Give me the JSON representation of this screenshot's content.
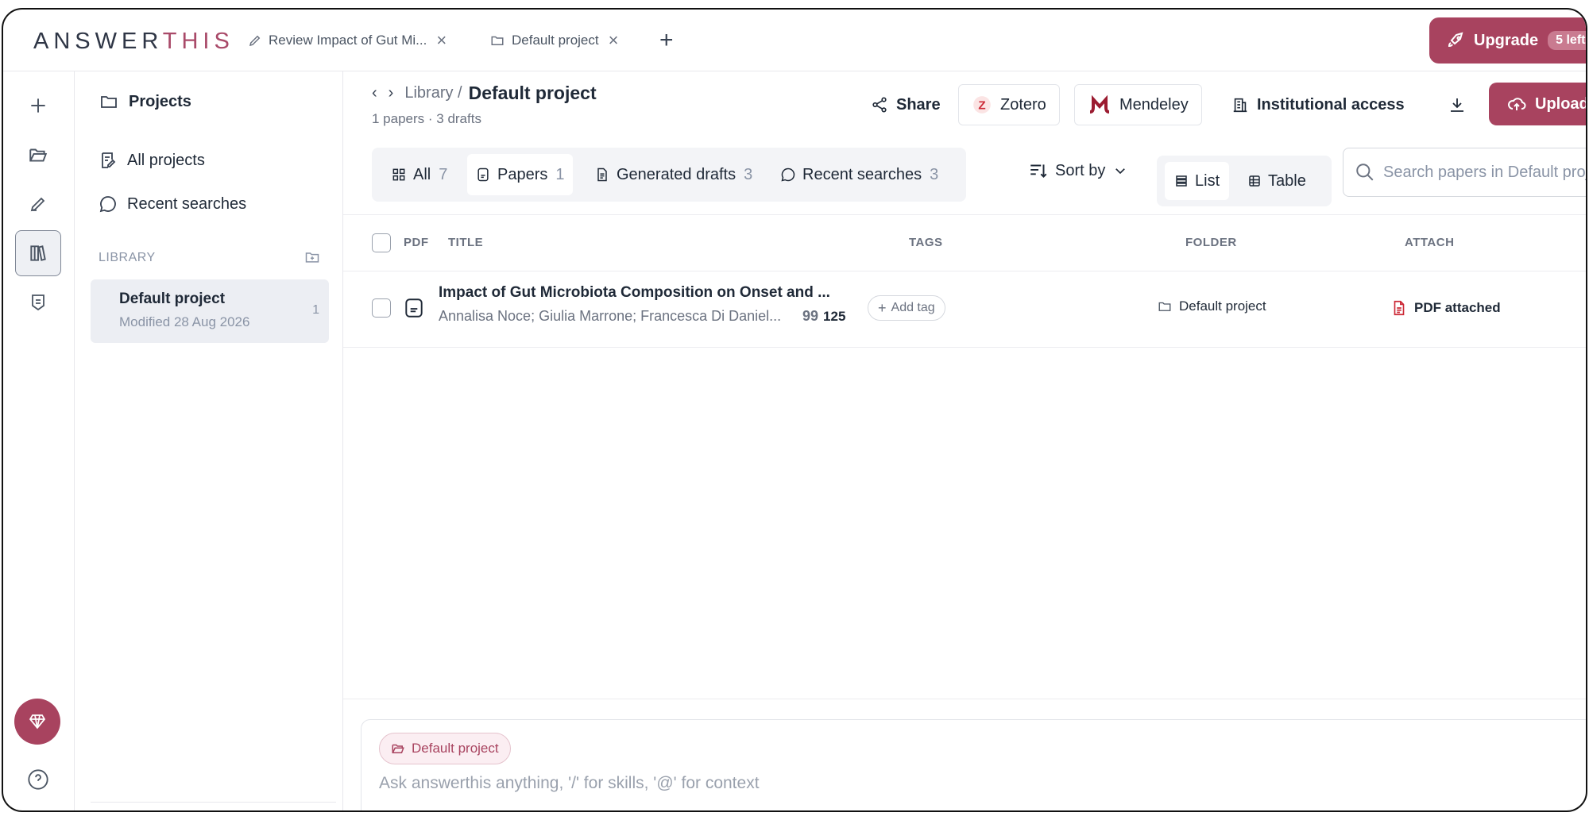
{
  "app": {
    "logo_main": "ANSWER",
    "logo_accent": "THIS"
  },
  "tabs": [
    {
      "label": "Review Impact of Gut Mi...",
      "icon": "pencil-icon"
    },
    {
      "label": "Default project",
      "icon": "folder-icon"
    }
  ],
  "upgrade": {
    "label": "Upgrade",
    "badge": "5 left"
  },
  "projects_panel": {
    "title": "Projects",
    "items": [
      {
        "label": "All projects",
        "icon": "notes-icon"
      },
      {
        "label": "Recent searches",
        "icon": "chat-bubble-icon"
      }
    ],
    "library_label": "LIBRARY",
    "project": {
      "name": "Default project",
      "modified": "Modified 28 Aug 2026",
      "count": "1"
    }
  },
  "header": {
    "breadcrumb_parent": "Library /",
    "breadcrumb_current": "Default project",
    "subtitle": "1 papers · 3 drafts",
    "share": "Share",
    "zotero": "Zotero",
    "mendeley": "Mendeley",
    "institutional": "Institutional access",
    "upload": "Upload"
  },
  "filter_tabs": [
    {
      "label": "All",
      "count": "7"
    },
    {
      "label": "Papers",
      "count": "1"
    },
    {
      "label": "Generated drafts",
      "count": "3"
    },
    {
      "label": "Recent searches",
      "count": "3"
    }
  ],
  "sort_label": "Sort by",
  "views": {
    "list": "List",
    "table": "Table"
  },
  "search": {
    "placeholder": "Search papers in Default project"
  },
  "table": {
    "columns": [
      "PDF",
      "TITLE",
      "TAGS",
      "FOLDER",
      "ATTACH"
    ],
    "rows": [
      {
        "title": "Impact of Gut Microbiota Composition on Onset and ...",
        "authors": "Annalisa Noce; Giulia Marrone; Francesca Di Daniel...",
        "citations": "125",
        "add_tag": "Add tag",
        "folder": "Default project",
        "attach": "PDF attached"
      }
    ]
  },
  "composer": {
    "context_chip": "Default project",
    "placeholder": "Ask answerthis anything, '/' for skills, '@' for context"
  },
  "colors": {
    "brand": "#a8435f",
    "text": "#1f2937",
    "muted": "#6b7280"
  }
}
